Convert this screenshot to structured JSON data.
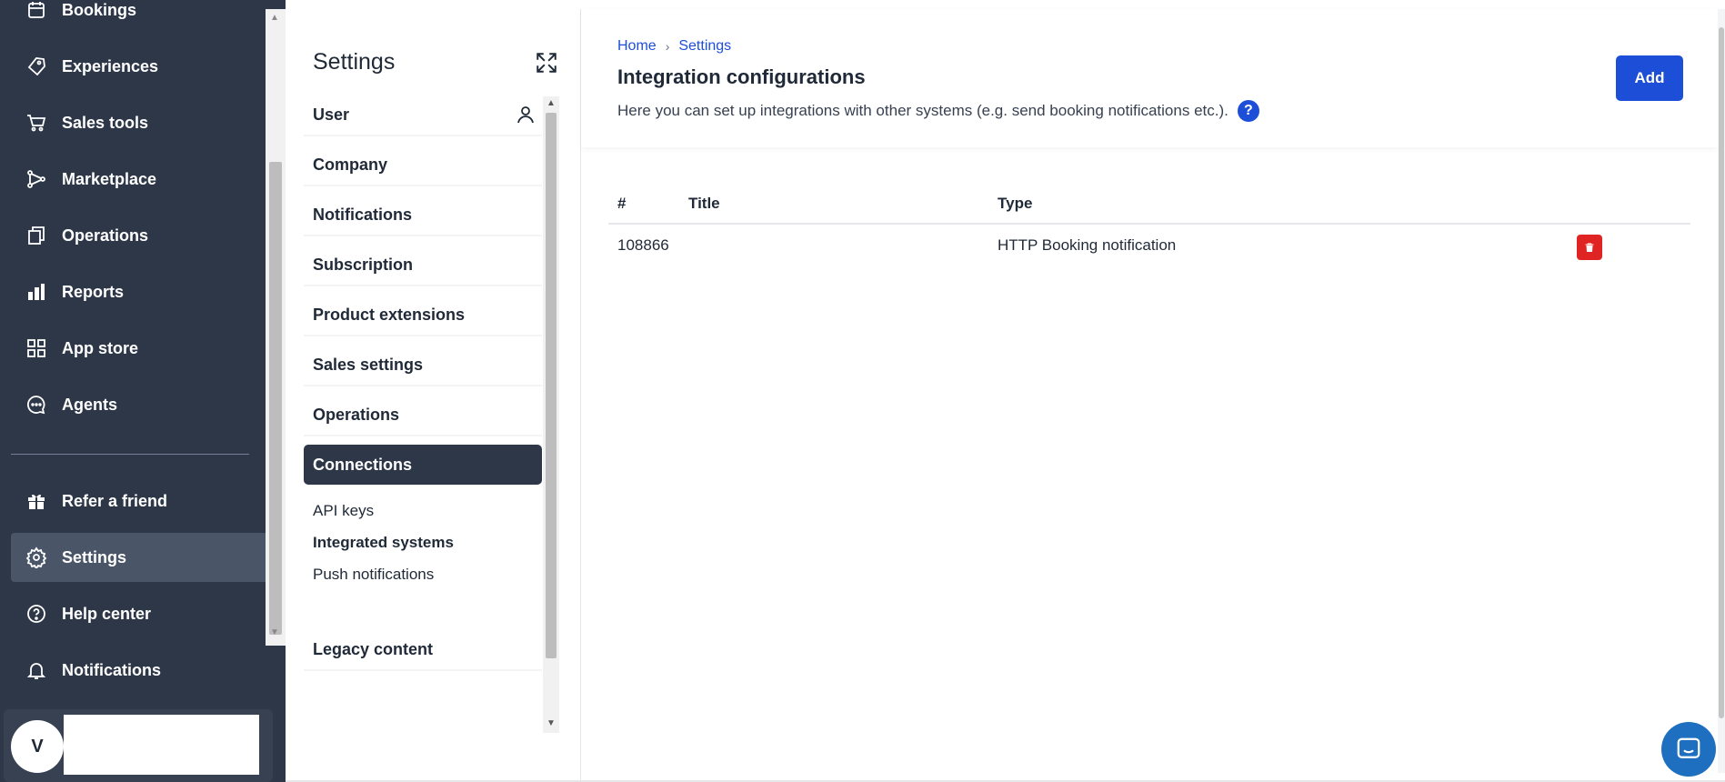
{
  "nav": {
    "items": [
      {
        "label": "Bookings",
        "icon": "calendar-icon"
      },
      {
        "label": "Experiences",
        "icon": "tag-icon"
      },
      {
        "label": "Sales tools",
        "icon": "cart-icon"
      },
      {
        "label": "Marketplace",
        "icon": "network-icon"
      },
      {
        "label": "Operations",
        "icon": "copy-icon"
      },
      {
        "label": "Reports",
        "icon": "bar-chart-icon"
      },
      {
        "label": "App store",
        "icon": "grid-icon"
      },
      {
        "label": "Agents",
        "icon": "chat-bubble-icon"
      },
      {
        "label": "Refer a friend",
        "icon": "gift-icon"
      },
      {
        "label": "Settings",
        "icon": "gear-icon"
      },
      {
        "label": "Help center",
        "icon": "question-circle-icon"
      },
      {
        "label": "Notifications",
        "icon": "bell-icon"
      }
    ],
    "active": "Settings",
    "user_initial": "V"
  },
  "settings": {
    "title": "Settings",
    "items": [
      {
        "label": "User"
      },
      {
        "label": "Company"
      },
      {
        "label": "Notifications"
      },
      {
        "label": "Subscription"
      },
      {
        "label": "Product extensions"
      },
      {
        "label": "Sales settings"
      },
      {
        "label": "Operations"
      },
      {
        "label": "Connections"
      },
      {
        "label": "Legacy content"
      }
    ],
    "active": "Connections",
    "sub_items": [
      {
        "label": "API keys"
      },
      {
        "label": "Integrated systems"
      },
      {
        "label": "Push notifications"
      }
    ],
    "active_sub": "Integrated systems"
  },
  "main": {
    "breadcrumb": [
      "Home",
      "Settings"
    ],
    "breadcrumb_sep": "›",
    "title": "Integration configurations",
    "description": "Here you can set up integrations with other systems (e.g. send booking notifications etc.).",
    "help_label": "?",
    "add_label": "Add",
    "table": {
      "headers": [
        "#",
        "Title",
        "Type"
      ],
      "rows": [
        {
          "id": "108866",
          "title": "",
          "type": "HTTP Booking notification"
        }
      ]
    }
  },
  "colors": {
    "nav_bg": "#2d3748",
    "primary": "#1d4ed8",
    "danger": "#e02424",
    "chat": "#1e6fbf"
  }
}
